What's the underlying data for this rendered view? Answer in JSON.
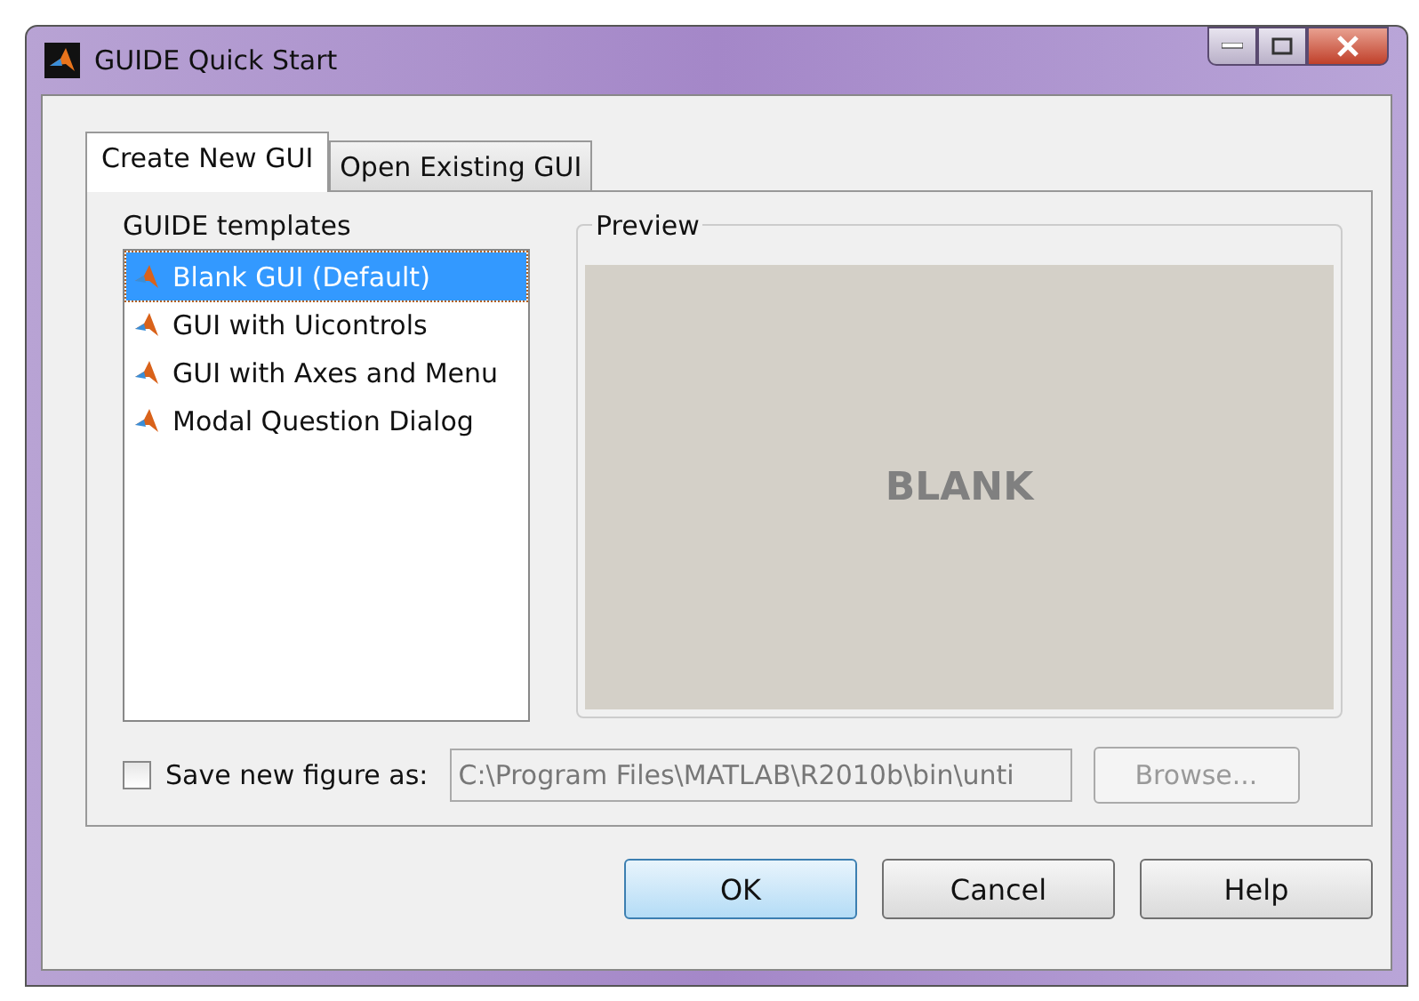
{
  "window": {
    "title": "GUIDE Quick Start"
  },
  "tabs": [
    {
      "label": "Create New GUI",
      "selected": true
    },
    {
      "label": "Open Existing GUI",
      "selected": false
    }
  ],
  "templates": {
    "label": "GUIDE templates",
    "items": [
      {
        "label": "Blank GUI (Default)",
        "selected": true
      },
      {
        "label": "GUI with Uicontrols",
        "selected": false
      },
      {
        "label": "GUI with Axes and Menu",
        "selected": false
      },
      {
        "label": "Modal Question Dialog",
        "selected": false
      }
    ]
  },
  "preview": {
    "label": "Preview",
    "text": "BLANK"
  },
  "save_figure": {
    "label": "Save new figure as:",
    "checked": false,
    "value": "C:\\Program Files\\MATLAB\\R2010b\\bin\\unti",
    "disabled": true,
    "browse": "Browse..."
  },
  "buttons": [
    {
      "label": "OK",
      "selected": true
    },
    {
      "label": "Cancel",
      "selected": false
    },
    {
      "label": "Help",
      "selected": false
    }
  ]
}
